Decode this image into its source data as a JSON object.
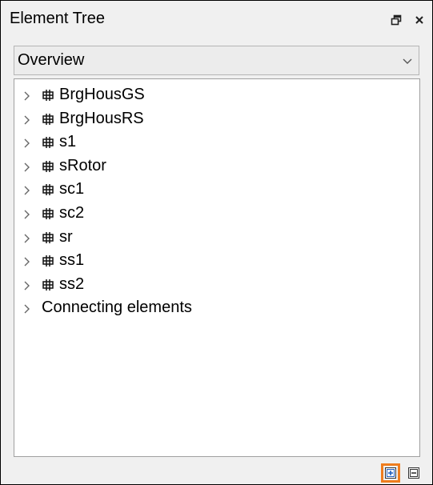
{
  "panel": {
    "title": "Element Tree",
    "float_icon": "float-window-icon",
    "close_icon": "close-icon"
  },
  "view_selector": {
    "value": "Overview",
    "icon": "chevron-down-icon"
  },
  "tree": {
    "items": [
      {
        "label": "BrgHousGS",
        "icon": "component-icon"
      },
      {
        "label": "BrgHousRS",
        "icon": "component-icon"
      },
      {
        "label": "s1",
        "icon": "component-icon"
      },
      {
        "label": "sRotor",
        "icon": "component-icon"
      },
      {
        "label": "sc1",
        "icon": "component-icon"
      },
      {
        "label": "sc2",
        "icon": "component-icon"
      },
      {
        "label": "sr",
        "icon": "component-icon"
      },
      {
        "label": "ss1",
        "icon": "component-icon"
      },
      {
        "label": "ss2",
        "icon": "component-icon"
      },
      {
        "label": "Connecting elements",
        "icon": ""
      }
    ]
  },
  "footer": {
    "expand_all_icon": "expand-all-icon",
    "collapse_all_icon": "collapse-all-icon"
  },
  "colors": {
    "highlight": "#ef7d1e",
    "panel_bg": "#f0f0f0",
    "accent_blue": "#1f5fbf"
  }
}
